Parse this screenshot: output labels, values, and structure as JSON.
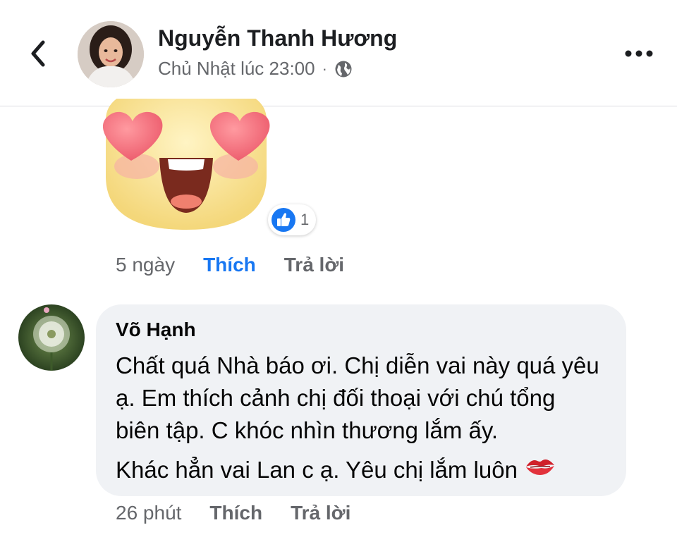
{
  "header": {
    "name": "Nguyễn Thanh Hương",
    "meta_time": "Chủ Nhật lúc 23:00",
    "meta_separator": "·",
    "icons": {
      "back": "chevron-left-icon",
      "privacy": "globe-icon",
      "more": "more-dots-icon"
    }
  },
  "comment1": {
    "sticker": "heart-eyes-sticker",
    "reaction": {
      "icon": "like-reaction-icon",
      "count": "1",
      "color": "#1877f2"
    },
    "time": "5 ngày",
    "like_label": "Thích",
    "like_color": "#1877f2",
    "reply_label": "Trả lời"
  },
  "comment2": {
    "author": "Võ Hạnh",
    "paragraphs": [
      "Chất quá Nhà báo ơi. Chị diễn vai này quá yêu ạ. Em thích cảnh chị đối thoại với chú tổng biên tập. C khóc nhìn thương lắm ấy.",
      "Khác hẳn vai Lan c ạ. Yêu chị lắm luôn"
    ],
    "emoji": "kiss-lips-icon",
    "time": "26 phút",
    "like_label": "Thích",
    "like_color": "#65676b",
    "reply_label": "Trả lời"
  }
}
